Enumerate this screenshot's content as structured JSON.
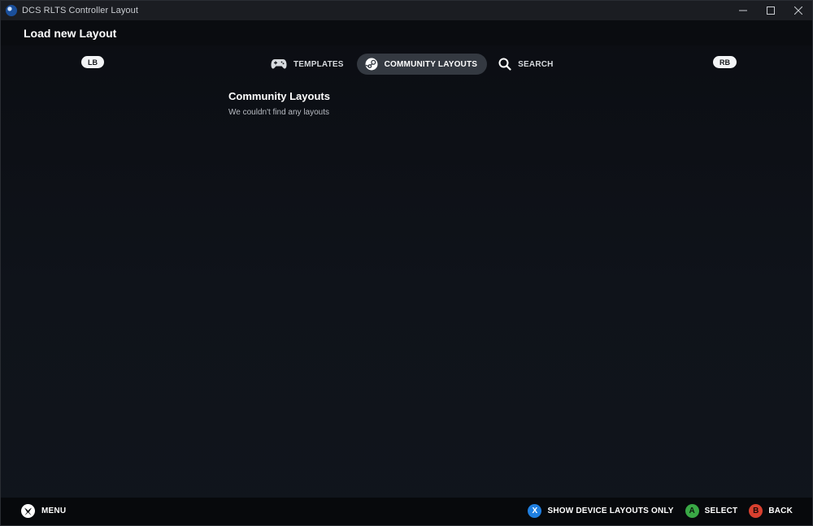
{
  "window": {
    "title": "DCS RLTS Controller Layout",
    "icon": "steam-icon",
    "controls": [
      "minimize-icon",
      "maximize-icon",
      "close-icon"
    ]
  },
  "header": {
    "title": "Load new Layout"
  },
  "bumpers": {
    "left": "LB",
    "right": "RB"
  },
  "tabs": [
    {
      "label": "TEMPLATES",
      "icon": "gamepad-icon",
      "active": false
    },
    {
      "label": "COMMUNITY LAYOUTS",
      "icon": "steam-icon",
      "active": true
    },
    {
      "label": "SEARCH",
      "icon": "search-icon",
      "active": false
    }
  ],
  "content": {
    "title": "Community Layouts",
    "message": "We couldn't find any layouts"
  },
  "footer": {
    "menu": {
      "label": "MENU",
      "icon": "xbox-icon"
    },
    "actions": [
      {
        "glyph": "X",
        "label": "SHOW DEVICE LAYOUTS ONLY",
        "color": "#1f7fe0"
      },
      {
        "glyph": "A",
        "label": "SELECT",
        "color": "#39a845"
      },
      {
        "glyph": "B",
        "label": "BACK",
        "color": "#d8402f"
      }
    ]
  },
  "colors": {
    "background": "#0e1116",
    "active_tab": "#343941",
    "titlebar": "#1b1d22"
  }
}
